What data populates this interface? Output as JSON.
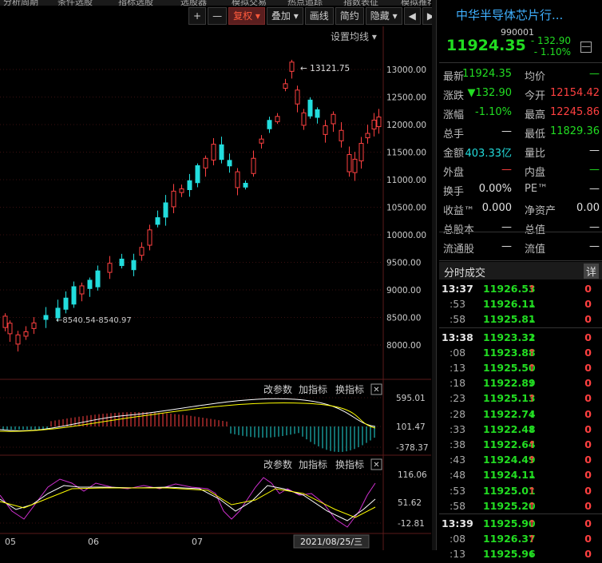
{
  "top_menu": [
    "分析周期",
    "条件选股",
    "指标选股",
    "选股器",
    "模拟交易",
    "热点追踪",
    "指数表征",
    "模拟推荐",
    "打开导航",
    "返回"
  ],
  "toolbar": {
    "plus": "+",
    "minus": "—",
    "fuquan": "复权 ▾",
    "diejia": "叠加 ▾",
    "huaxian": "画线",
    "jianyue": "简约",
    "yincang": "隐藏 ▾",
    "prev": "◀",
    "next": "▶"
  },
  "ma_setting": "设置均线 ▾",
  "main_axis": [
    "13000.00",
    "12500.00",
    "12000.00",
    "11500.00",
    "11000.00",
    "10500.00",
    "10000.00",
    "9500.00",
    "9000.00",
    "8500.00",
    "8000.00"
  ],
  "high_label": "13121.75",
  "low_label": "8540.54-8540.97",
  "macd_panel": {
    "btn1": "改参数",
    "btn2": "加指标",
    "btn3": "换指标",
    "close": "✕",
    "axis": [
      "595.01",
      "101.47",
      "-378.37"
    ]
  },
  "kdj_panel": {
    "btn1": "改参数",
    "btn2": "加指标",
    "btn3": "换指标",
    "close": "✕",
    "axis": [
      "116.06",
      "51.62",
      "-12.81"
    ]
  },
  "x_axis": [
    "05",
    "06",
    "07"
  ],
  "date_badge": "2021/08/25/三",
  "quote": {
    "name": "中华半导体芯片行...",
    "code": "990001",
    "price": "11924.35",
    "change": "- 132.90",
    "change_pct": "- 1.10%",
    "minus_btn": "—",
    "rows": [
      {
        "l1": "最新",
        "v1": "11924.35",
        "c1": "g",
        "l2": "均价",
        "v2": "—",
        "c2": "g"
      },
      {
        "l1": "涨跌",
        "v1": "▼132.90",
        "c1": "g",
        "l2": "今开",
        "v2": "12154.42",
        "c2": "r"
      },
      {
        "l1": "涨幅",
        "v1": "-1.10%",
        "c1": "g",
        "l2": "最高",
        "v2": "12245.86",
        "c2": "r"
      },
      {
        "l1": "总手",
        "v1": "—",
        "c1": "w",
        "l2": "最低",
        "v2": "11829.36",
        "c2": "g"
      },
      {
        "l1": "金额",
        "v1": "403.33亿",
        "c1": "c",
        "l2": "量比",
        "v2": "—",
        "c2": "w"
      },
      {
        "l1": "外盘",
        "v1": "—",
        "c1": "r",
        "l2": "内盘",
        "v2": "—",
        "c2": "g"
      },
      {
        "l1": "换手",
        "v1": "0.00%",
        "c1": "w",
        "l2": "PE™",
        "v2": "—",
        "c2": "w"
      },
      {
        "l1": "收益™",
        "v1": "0.000",
        "c1": "w",
        "l2": "净资产",
        "v2": "0.00",
        "c2": "w"
      },
      {
        "l1": "总股本",
        "v1": "—",
        "c1": "w",
        "l2": "总值",
        "v2": "—",
        "c2": "w"
      },
      {
        "l1": "流通股",
        "v1": "—",
        "c1": "w",
        "l2": "流值",
        "v2": "—",
        "c2": "w"
      }
    ]
  },
  "ticks_header": {
    "title": "分时成交",
    "detail": "详"
  },
  "ticks": [
    {
      "time": "13:37",
      "price": "11926.53",
      "dir": "up",
      "vol": "0",
      "sub": false
    },
    {
      "time": ":53",
      "price": "11926.11",
      "dir": "down",
      "vol": "0",
      "sub": true
    },
    {
      "time": ":58",
      "price": "11925.81",
      "dir": "down",
      "vol": "0",
      "sub": true
    },
    {
      "time": "13:38",
      "price": "11923.32",
      "dir": "down",
      "vol": "0",
      "sub": false
    },
    {
      "time": ":08",
      "price": "11923.88",
      "dir": "up",
      "vol": "0",
      "sub": true
    },
    {
      "time": ":13",
      "price": "11925.50",
      "dir": "up",
      "vol": "0",
      "sub": true
    },
    {
      "time": ":18",
      "price": "11922.89",
      "dir": "down",
      "vol": "0",
      "sub": true
    },
    {
      "time": ":23",
      "price": "11925.13",
      "dir": "up",
      "vol": "0",
      "sub": true
    },
    {
      "time": ":28",
      "price": "11922.74",
      "dir": "down",
      "vol": "0",
      "sub": true
    },
    {
      "time": ":33",
      "price": "11922.48",
      "dir": "down",
      "vol": "0",
      "sub": true
    },
    {
      "time": ":38",
      "price": "11922.64",
      "dir": "up",
      "vol": "0",
      "sub": true
    },
    {
      "time": ":43",
      "price": "11924.49",
      "dir": "up",
      "vol": "0",
      "sub": true
    },
    {
      "time": ":48",
      "price": "11924.11",
      "dir": "down",
      "vol": "0",
      "sub": true
    },
    {
      "time": ":53",
      "price": "11925.01",
      "dir": "up",
      "vol": "0",
      "sub": true
    },
    {
      "time": ":58",
      "price": "11925.20",
      "dir": "up",
      "vol": "0",
      "sub": true
    },
    {
      "time": "13:39",
      "price": "11925.90",
      "dir": "up",
      "vol": "0",
      "sub": false
    },
    {
      "time": ":08",
      "price": "11926.37",
      "dir": "up",
      "vol": "0",
      "sub": true
    },
    {
      "time": ":13",
      "price": "11925.96",
      "dir": "down",
      "vol": "0",
      "sub": true
    }
  ],
  "colors": {
    "up": "#ff4040",
    "down": "#22dddd",
    "green": "#22dd22",
    "grid": "#3a1010"
  }
}
